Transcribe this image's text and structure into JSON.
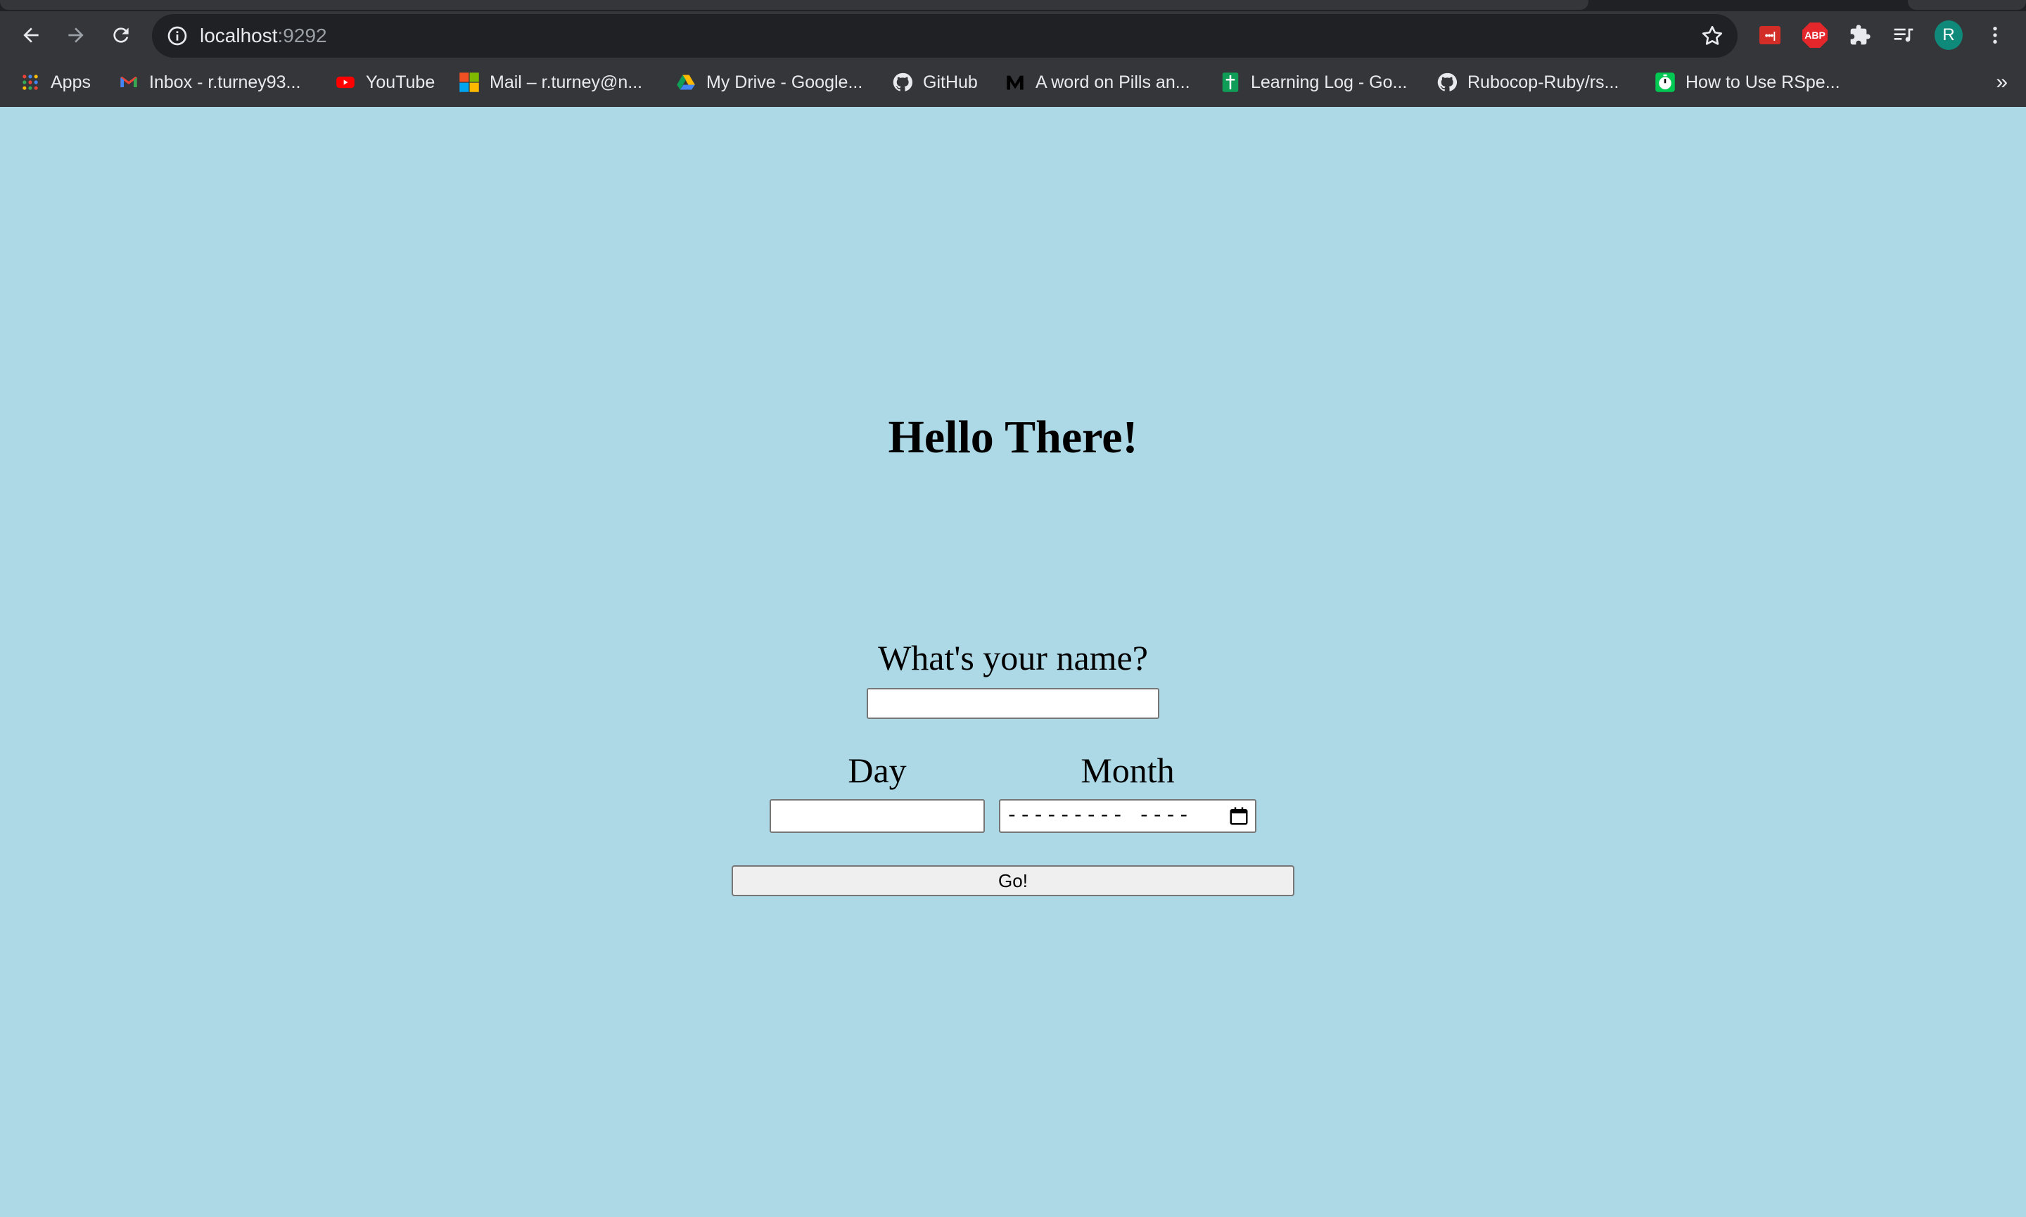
{
  "browser": {
    "url_host": "localhost",
    "url_port": ":9292",
    "profile_initial": "R",
    "extensions": {
      "lastpass_label": "•••|",
      "abp_label": "ABP"
    }
  },
  "bookmarks": {
    "items": [
      {
        "label": "Apps",
        "icon": "apps-grid-icon"
      },
      {
        "label": "Inbox - r.turney93...",
        "icon": "gmail-icon"
      },
      {
        "label": "YouTube",
        "icon": "youtube-icon"
      },
      {
        "label": "Mail – r.turney@n...",
        "icon": "microsoft-icon"
      },
      {
        "label": "My Drive - Google...",
        "icon": "google-drive-icon"
      },
      {
        "label": "GitHub",
        "icon": "github-icon"
      },
      {
        "label": "A word on Pills an...",
        "icon": "medium-icon"
      },
      {
        "label": "Learning Log - Go...",
        "icon": "google-sheets-icon"
      },
      {
        "label": "Rubocop-Ruby/rs...",
        "icon": "github-icon"
      },
      {
        "label": "How to Use RSpe...",
        "icon": "timer-icon"
      }
    ],
    "overflow": "»"
  },
  "page": {
    "heading": "Hello There!",
    "name_label": "What's your name?",
    "name_value": "",
    "day_label": "Day",
    "day_value": "",
    "month_label": "Month",
    "month_placeholder": "---------  ----",
    "go_label": "Go!",
    "background_color": "#add8e6"
  }
}
